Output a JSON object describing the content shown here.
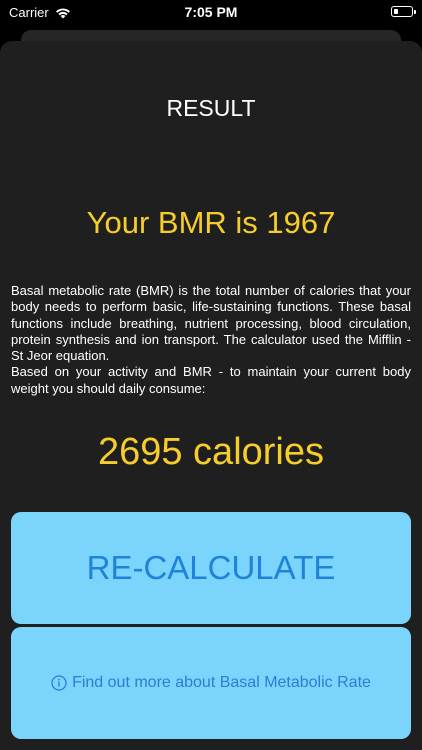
{
  "status_bar": {
    "carrier": "Carrier",
    "time": "7:05 PM",
    "wifi_icon": "wifi-icon",
    "battery_icon": "battery-icon"
  },
  "result": {
    "title": "RESULT",
    "bmr_text": "Your BMR is 1967",
    "description_1": "Basal metabolic rate (BMR) is the total number of calories that your body needs to perform basic, life-sustaining functions. These basal functions include breathing, nutrient processing, blood circulation, protein synthesis and ion transport. The calculator used the Mifflin - St Jeor equation.",
    "description_2": "Based on your activity and BMR - to maintain your current body weight you should daily consume:",
    "calories_text": "2695 calories"
  },
  "buttons": {
    "recalculate_label": "RE-CALCULATE",
    "info_label": "Find out more about Basal Metabolic Rate",
    "info_icon": "info-circle-icon"
  },
  "colors": {
    "background": "#000000",
    "sheet": "#1f1f1f",
    "accent_yellow": "#f7cd2b",
    "button_bg": "#7bd4fb",
    "button_text": "#1f83d9"
  }
}
